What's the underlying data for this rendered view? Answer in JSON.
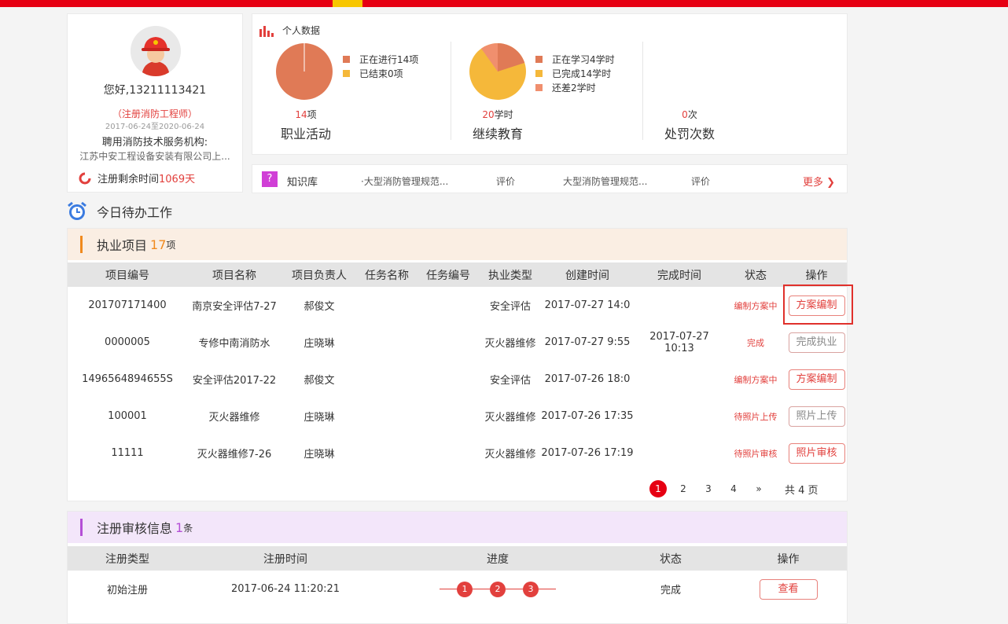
{
  "colors": {
    "brand_red": "#e60012",
    "accent_yellow": "#f7c600",
    "pie_orange": "#e07a56",
    "pie_yellow": "#f5b83a",
    "pie_salmon": "#f08f6e"
  },
  "profile": {
    "greeting": "您好,13211113421",
    "role": "（注册消防工程师）",
    "dates": "2017-06-24至2020-06-24",
    "org_label": "聘用消防技术服务机构:",
    "org_name": "江苏中安工程设备安装有限公司上...",
    "remain_label": "注册剩余时间",
    "remain_value": "1069天"
  },
  "stats": {
    "title": "个人数据",
    "practice": {
      "legend": [
        "正在进行14项",
        "已结束0项"
      ],
      "num": "14",
      "unit": "项",
      "label": "职业活动",
      "pie": [
        14,
        0
      ]
    },
    "education": {
      "legend": [
        "正在学习4学时",
        "已完成14学时",
        "还差2学时"
      ],
      "num": "20",
      "unit": "学时",
      "label": "继续教育",
      "pie": [
        4,
        14,
        2
      ]
    },
    "penalty": {
      "num": "0",
      "unit": "次",
      "label": "处罚次数"
    }
  },
  "knowledge": {
    "label": "知识库",
    "items": [
      "·大型消防管理规范...",
      "评价",
      "大型消防管理规范...",
      "评价"
    ],
    "more": "更多 ❯"
  },
  "todo_title": "今日待办工作",
  "projects": {
    "title": "执业项目",
    "count": "17",
    "unit": "项",
    "headers": [
      "项目编号",
      "项目名称",
      "项目负责人",
      "任务名称",
      "任务编号",
      "执业类型",
      "创建时间",
      "完成时间",
      "状态",
      "操作"
    ],
    "rows": [
      {
        "id": "201707171400",
        "name": "南京安全评估7-27",
        "owner": "郝俊文",
        "task": "",
        "task_no": "",
        "type": "安全评估",
        "created": "2017-07-27 14:0",
        "done": "",
        "status": "编制方案中",
        "action": "方案编制"
      },
      {
        "id": "0000005",
        "name": "专修中南消防水",
        "owner": "庄晓琳",
        "task": "",
        "task_no": "",
        "type": "灭火器维修",
        "created": "2017-07-27 9:55",
        "done": "2017-07-27 10:13",
        "status": "完成",
        "action": "完成执业"
      },
      {
        "id": "1496564894655S",
        "name": "安全评估2017-22",
        "owner": "郝俊文",
        "task": "",
        "task_no": "",
        "type": "安全评估",
        "created": "2017-07-26 18:0",
        "done": "",
        "status": "编制方案中",
        "action": "方案编制"
      },
      {
        "id": "100001",
        "name": "灭火器维修",
        "owner": "庄晓琳",
        "task": "",
        "task_no": "",
        "type": "灭火器维修",
        "created": "2017-07-26 17:35",
        "done": "",
        "status": "待照片上传",
        "action": "照片上传"
      },
      {
        "id": "11111",
        "name": "灭火器维修7-26",
        "owner": "庄晓琳",
        "task": "",
        "task_no": "",
        "type": "灭火器维修",
        "created": "2017-07-26 17:19",
        "done": "",
        "status": "待照片审核",
        "action": "照片审核"
      }
    ],
    "pages": [
      "1",
      "2",
      "3",
      "4",
      "»"
    ],
    "total": "共 4 页"
  },
  "registration": {
    "title": "注册审核信息",
    "count": "1",
    "unit": "条",
    "headers": [
      "注册类型",
      "注册时间",
      "进度",
      "状态",
      "操作"
    ],
    "rows": [
      {
        "type": "初始注册",
        "time": "2017-06-24 11:20:21",
        "steps": [
          "1",
          "2",
          "3"
        ],
        "status": "完成",
        "action": "查看"
      }
    ]
  }
}
